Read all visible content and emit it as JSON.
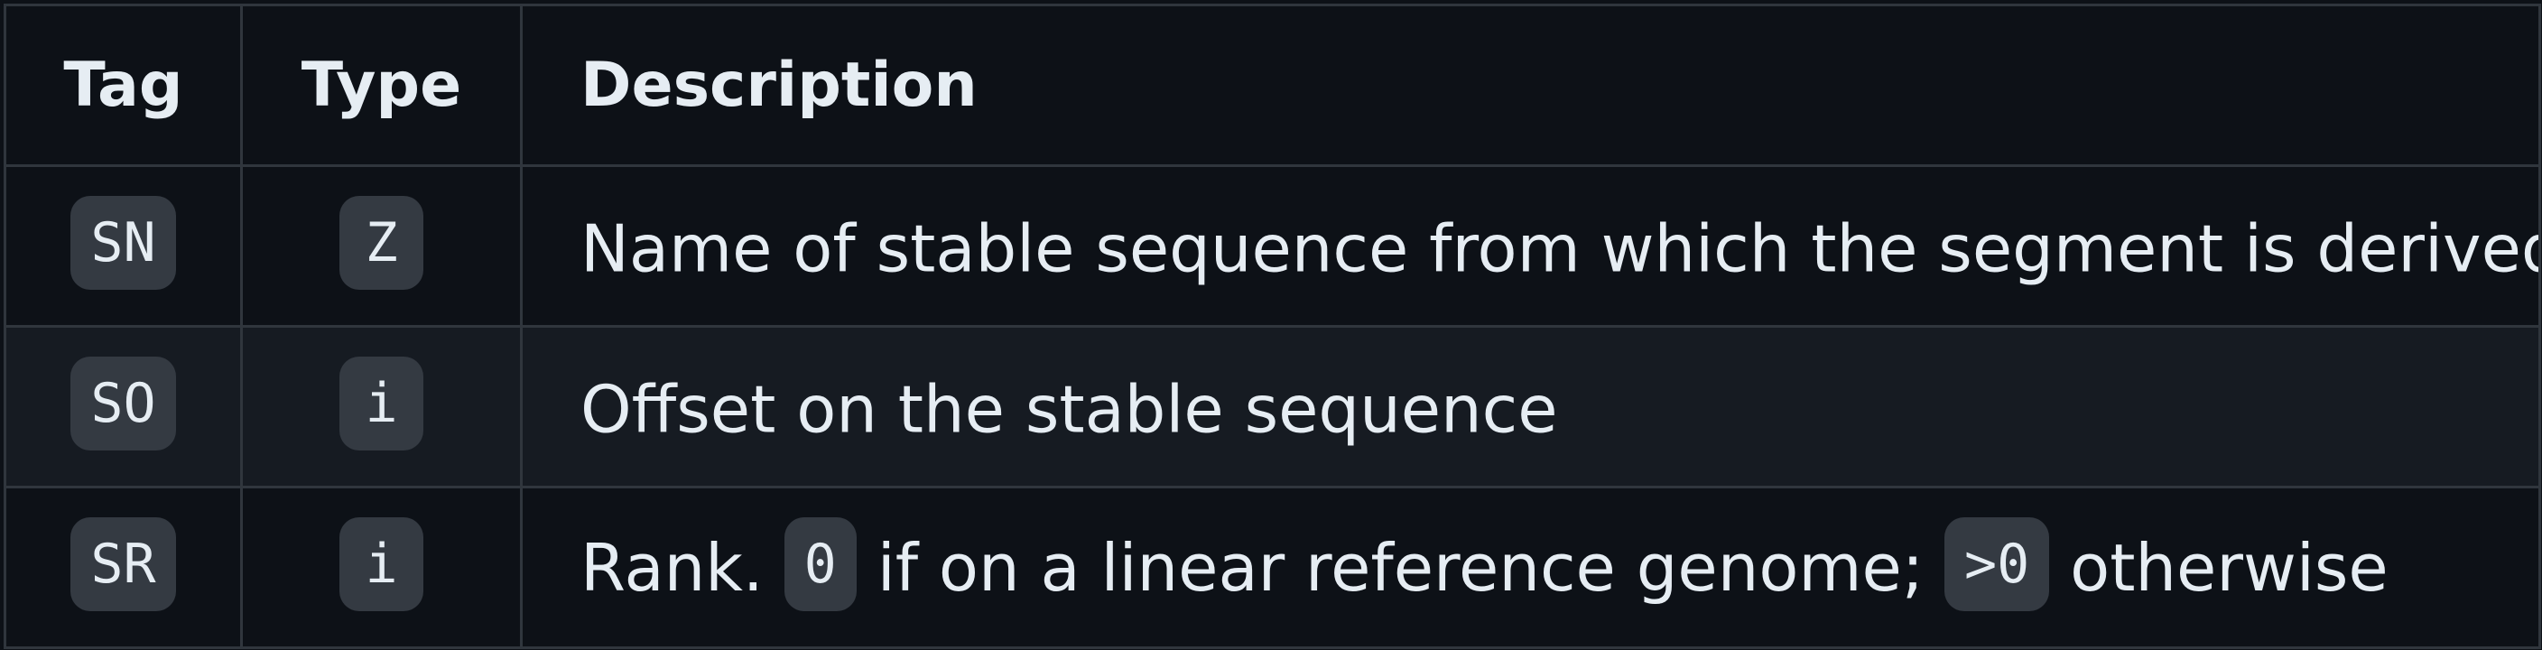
{
  "table": {
    "headers": {
      "tag": "Tag",
      "type": "Type",
      "description": "Description"
    },
    "rows": [
      {
        "tag": "SN",
        "type": "Z",
        "description": "Name of stable sequence from which the segment is derived"
      },
      {
        "tag": "SO",
        "type": "i",
        "description": "Offset on the stable sequence"
      },
      {
        "tag": "SR",
        "type": "i",
        "description_parts": {
          "text1": "Rank.",
          "code1": "0",
          "text2": "if on a linear reference genome;",
          "code2": ">0",
          "text3": "otherwise"
        }
      }
    ]
  },
  "colors": {
    "background": "#0d1117",
    "row_alt": "#161b22",
    "border": "#30363d",
    "code_bg": "#343a42",
    "text": "#e6edf3"
  }
}
